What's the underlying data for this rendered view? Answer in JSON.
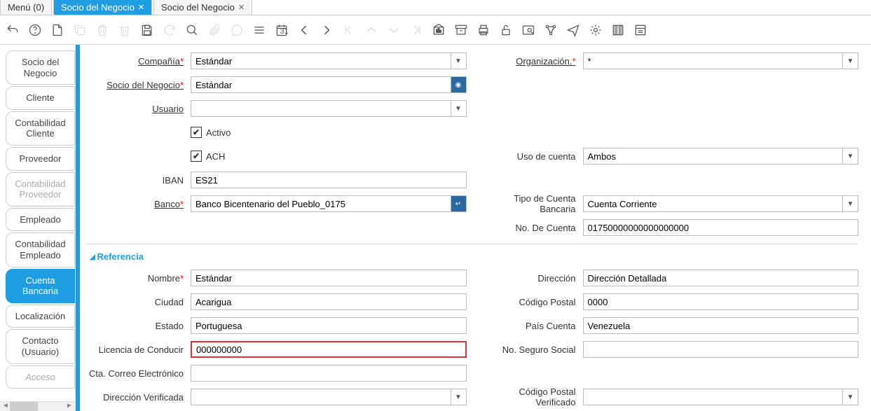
{
  "tabs": [
    {
      "label": "Menú (0)",
      "closable": false
    },
    {
      "label": "Socio del Negocio",
      "active": true,
      "closable": true
    },
    {
      "label": "Socio del Negocio",
      "closable": true
    }
  ],
  "sidebar": {
    "items": [
      {
        "label": "Socio del Negocio"
      },
      {
        "label": "Cliente"
      },
      {
        "label": "Contabilidad Cliente"
      },
      {
        "label": "Proveedor"
      },
      {
        "label": "Contabilidad Proveedor",
        "disabled": true
      },
      {
        "label": "Empleado"
      },
      {
        "label": "Contabilidad Empleado"
      },
      {
        "label": "Cuenta Bancaria",
        "active": true
      },
      {
        "label": "Localización"
      },
      {
        "label": "Contacto (Usuario)"
      },
      {
        "label": "Acceso",
        "disabled": true
      }
    ]
  },
  "form": {
    "compania": {
      "label": "Compañía",
      "value": "Estándar",
      "required": true,
      "link": true
    },
    "organizacion": {
      "label": "Organización.",
      "value": "*",
      "required": true,
      "link": true
    },
    "socio": {
      "label": "Socio del Negocio",
      "value": "Estándar",
      "required": true,
      "link": true
    },
    "usuario": {
      "label": "Usuario",
      "value": "",
      "link": true
    },
    "activo": {
      "label": "Activo",
      "checked": true
    },
    "ach": {
      "label": "ACH",
      "checked": true
    },
    "uso_cuenta": {
      "label": "Uso de cuenta",
      "value": "Ambos"
    },
    "iban": {
      "label": "IBAN",
      "value": "ES21"
    },
    "banco": {
      "label": "Banco",
      "value": "Banco Bicentenario del Pueblo_0175",
      "required": true,
      "link": true
    },
    "tipo_cuenta": {
      "label": "Tipo de Cuenta Bancaria",
      "value": "Cuenta Corriente"
    },
    "no_cuenta": {
      "label": "No. De Cuenta",
      "value": "01750000000000000000"
    }
  },
  "ref": {
    "title": "Referencia",
    "nombre": {
      "label": "Nombre",
      "value": "Estándar",
      "required": true
    },
    "direccion": {
      "label": "Dirección",
      "value": "Dirección Detallada"
    },
    "ciudad": {
      "label": "Ciudad",
      "value": "Acarigua"
    },
    "codigo_postal": {
      "label": "Código Postal",
      "value": "0000"
    },
    "estado": {
      "label": "Estado",
      "value": "Portuguesa"
    },
    "pais": {
      "label": "País Cuenta",
      "value": "Venezuela"
    },
    "licencia": {
      "label": "Licencia de Conducir",
      "value": "000000000"
    },
    "seguro": {
      "label": "No. Seguro Social",
      "value": ""
    },
    "correo": {
      "label": "Cta. Correo Electrónico",
      "value": ""
    },
    "dir_verif": {
      "label": "Dirección Verificada",
      "value": ""
    },
    "cp_verif": {
      "label": "Código Postal Verificado",
      "value": ""
    }
  }
}
